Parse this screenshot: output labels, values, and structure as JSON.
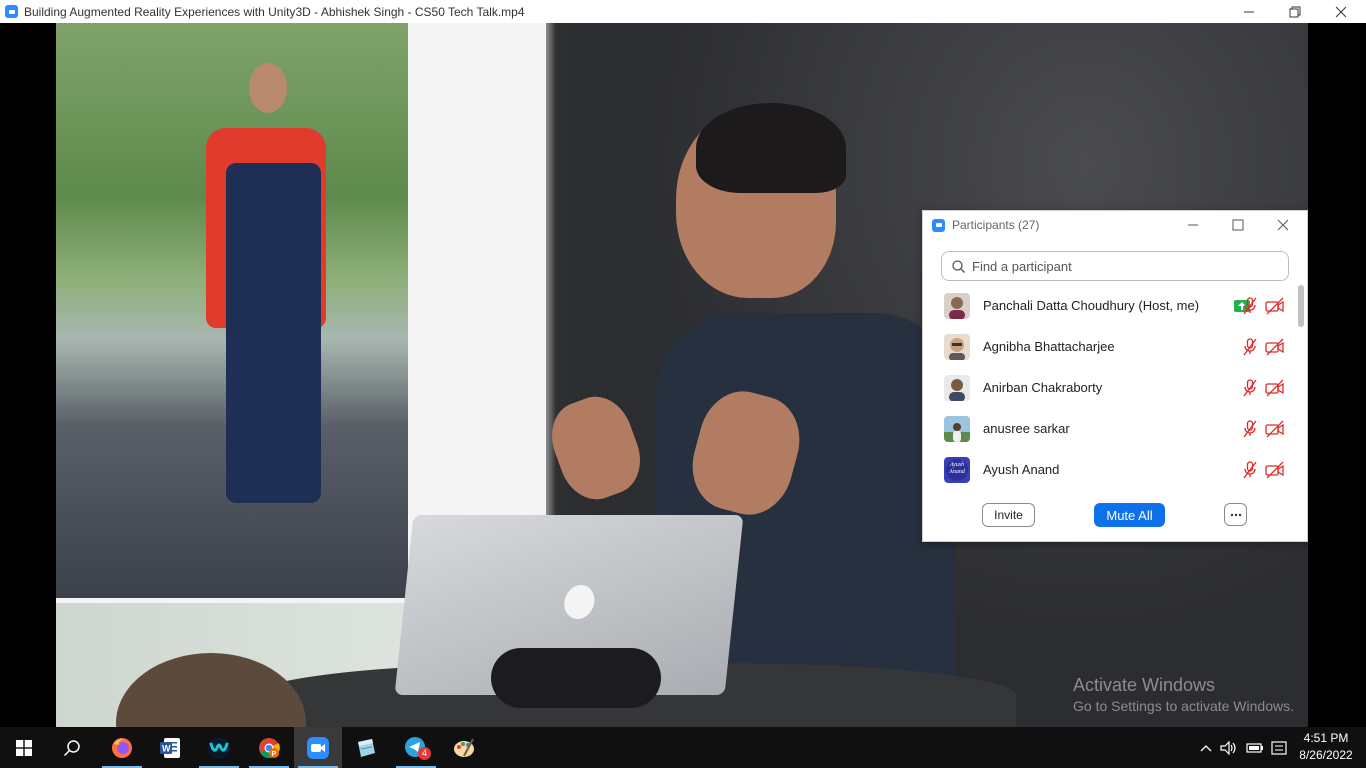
{
  "window": {
    "title": "Building Augmented Reality Experiences with Unity3D - Abhishek Singh - CS50 Tech Talk.mp4",
    "minimize_icon": "minimize-icon",
    "restore_icon": "restore-icon",
    "close_icon": "close-icon"
  },
  "watermark": {
    "line1": "Activate Windows",
    "line2": "Go to Settings to activate Windows."
  },
  "participants_panel": {
    "title": "Participants (27)",
    "search_placeholder": "Find a participant",
    "participants": [
      {
        "name": "Panchali Datta Choudhury (Host, me)",
        "sharing": true,
        "muted": true,
        "video_off": true,
        "avatar_color": "#8a6a4e"
      },
      {
        "name": "Agnibha Bhattacharjee",
        "sharing": false,
        "muted": true,
        "video_off": true,
        "avatar_color": "#c9a27c"
      },
      {
        "name": "Anirban Chakraborty",
        "sharing": false,
        "muted": true,
        "video_off": true,
        "avatar_color": "#7a5a40"
      },
      {
        "name": "anusree sarkar",
        "sharing": false,
        "muted": true,
        "video_off": true,
        "avatar_color": "#6f9fbf"
      },
      {
        "name": "Ayush Anand",
        "sharing": false,
        "muted": true,
        "video_off": true,
        "avatar_color": "#3a3fb8",
        "avatar_text": "Ayush Anand"
      }
    ],
    "invite_label": "Invite",
    "mute_all_label": "Mute All",
    "more_label": "...",
    "colors": {
      "accent": "#0e71eb",
      "muted_red": "#e02828",
      "share_green": "#23b14d"
    }
  },
  "taskbar": {
    "items": [
      "start-icon",
      "search-icon",
      "firefox-icon",
      "word-icon",
      "webex-icon",
      "chrome-icon",
      "zoom-icon",
      "notepad-icon",
      "telegram-icon",
      "paint-icon"
    ],
    "telegram_badge": "4",
    "time": "4:51 PM",
    "date": "8/26/2022"
  }
}
